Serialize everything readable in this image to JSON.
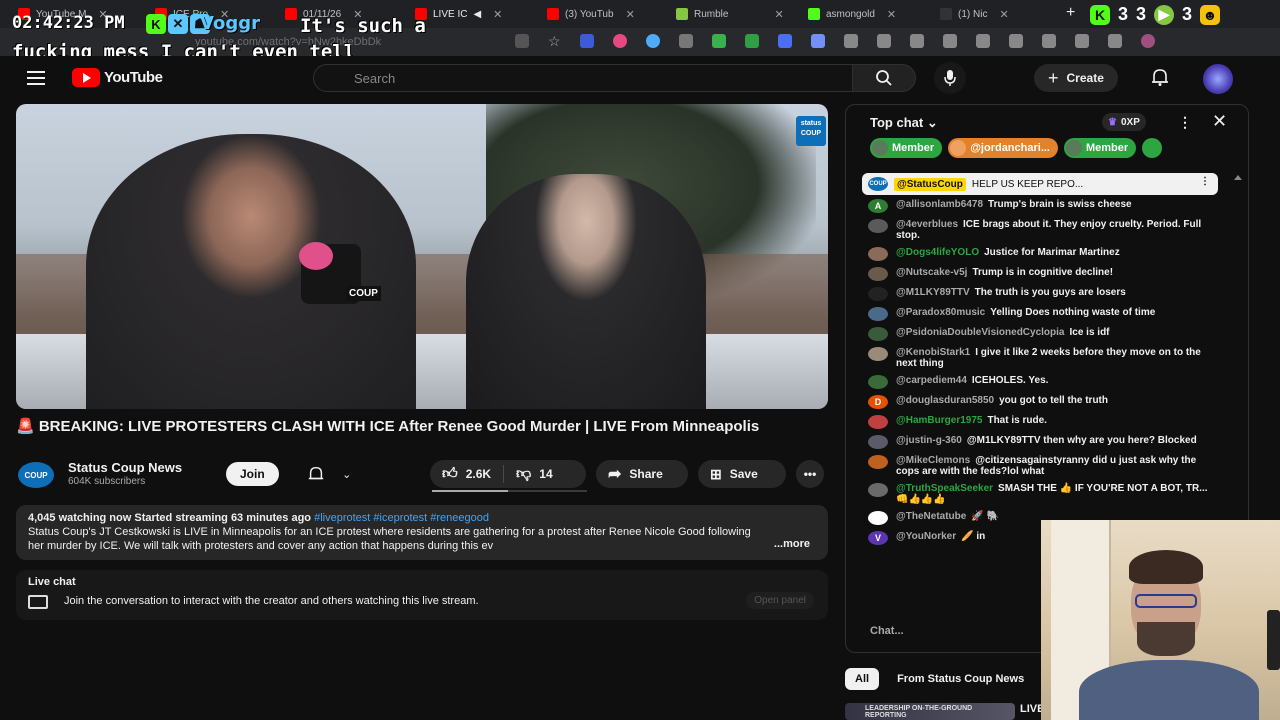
{
  "browser": {
    "tabs": [
      {
        "label": "YouTube M",
        "color": "#ff0000"
      },
      {
        "label": "ICE Pro",
        "color": "#ff0000"
      },
      {
        "label": "01/11/26",
        "color": "#ff0000"
      },
      {
        "label": "LIVE IC",
        "color": "#ff0000"
      },
      {
        "label": "(3) YouTub",
        "color": "#ff0000"
      },
      {
        "label": "Rumble",
        "color": "#85c742"
      },
      {
        "label": "asmongold",
        "color": "#53fc18"
      },
      {
        "label": "(1) Nic",
        "color": "#333333"
      }
    ],
    "url": "youtube.com/watch?v=hNw2hkeDbDk"
  },
  "overlay": {
    "clock": "02:42:23 PM",
    "caption_user": "Voggr",
    "caption_text": "It's such a fucking mess I can't even tell",
    "ext_count": "3",
    "ext_count2": "3"
  },
  "masthead": {
    "logo_text": "YouTube",
    "search_placeholder": "Search",
    "create_label": "Create"
  },
  "video": {
    "mic_label": "COUP",
    "watermark": "status COUP",
    "title": "🚨 BREAKING: LIVE PROTESTERS CLASH WITH ICE After Renee Good Murder | LIVE From Minneapolis",
    "channel": {
      "logo": "COUP",
      "name": "Status Coup News",
      "subscribers": "604K subscribers",
      "join_label": "Join"
    },
    "actions": {
      "likes": "2.6K",
      "dislikes": "14",
      "share_label": "Share",
      "save_label": "Save"
    },
    "description": {
      "stats": "4,045 watching now  Started streaming 63 minutes ago",
      "tags": "#liveprotest #iceprotest #reneegood",
      "body": "Status Coup's JT Cestkowski is LIVE in Minneapolis for an ICE protest where residents are gathering for a protest after Renee Nicole Good following her murder by ICE. We will talk with protesters and cover any action that happens during this ev",
      "more_label": "...more"
    },
    "live_chat_box": {
      "title": "Live chat",
      "text": "Join the conversation to interact with the creator and others watching this live stream.",
      "open_label": "Open panel"
    }
  },
  "chat": {
    "header": "Top chat",
    "xp": "0XP",
    "tickers": [
      {
        "label": "Member",
        "color": "#2ba640"
      },
      {
        "label": "@jordanchari...",
        "color": "#e2822a"
      },
      {
        "label": "Member",
        "color": "#2ba640"
      }
    ],
    "pinned": {
      "avatar": "COUP",
      "user": "@StatusCoup",
      "text": "HELP US KEEP REPO..."
    },
    "messages": [
      {
        "initial": "A",
        "avatar_color": "#2e7d32",
        "user": "@allisonlamb6478",
        "member": false,
        "text": "Trump's brain is swiss cheese"
      },
      {
        "initial": "",
        "avatar_color": "#5a5a5a",
        "user": "@4everblues",
        "member": false,
        "text": "ICE brags about it. They enjoy cruelty. Period. Full stop."
      },
      {
        "initial": "",
        "avatar_color": "#8a6a5a",
        "user": "@Dogs4lifeYOLO",
        "member": true,
        "text": "Justice for Marimar Martinez"
      },
      {
        "initial": "",
        "avatar_color": "#6a5a4a",
        "user": "@Nutscake-v5j",
        "member": false,
        "text": "Trump is in cognitive decline!"
      },
      {
        "initial": "",
        "avatar_color": "#222222",
        "user": "@M1LKY89TTV",
        "member": false,
        "text": "The truth is you guys are losers"
      },
      {
        "initial": "",
        "avatar_color": "#4a6a8a",
        "user": "@Paradox80music",
        "member": false,
        "text": "Yelling Does nothing waste of time"
      },
      {
        "initial": "",
        "avatar_color": "#3a5a3a",
        "user": "@PsidoniaDoubleVisionedCyclopia",
        "member": false,
        "text": "Ice is idf"
      },
      {
        "initial": "",
        "avatar_color": "#9a8a7a",
        "user": "@KenobiStark1",
        "member": false,
        "text": "I give it like 2 weeks before they move on to the next thing"
      },
      {
        "initial": "",
        "avatar_color": "#3a6a3a",
        "user": "@carpediem44",
        "member": false,
        "text": "ICEHOLES. Yes."
      },
      {
        "initial": "D",
        "avatar_color": "#e65100",
        "user": "@douglasduran5850",
        "member": false,
        "text": "you got to tell the truth"
      },
      {
        "initial": "",
        "avatar_color": "#c04040",
        "user": "@HamBurger1975",
        "member": true,
        "text": "That is rude."
      },
      {
        "initial": "",
        "avatar_color": "#5a5a6a",
        "user": "@justin-g-360",
        "member": false,
        "text": "@M1LKY89TTV then why are you here? Blocked"
      },
      {
        "initial": "",
        "avatar_color": "#c06020",
        "user": "@MikeClemons",
        "member": false,
        "text": "@citizensagainstyranny did u just ask why the cops are with the feds?lol what"
      },
      {
        "initial": "",
        "avatar_color": "#6a6a6a",
        "user": "@TruthSpeakSeeker",
        "member": true,
        "text": "SMASH THE 👍 IF YOU'RE NOT A BOT, TR... 👊👍👍👍"
      },
      {
        "initial": "",
        "avatar_color": "#ffffff",
        "user": "@TheNetatube",
        "member": false,
        "text": "🚀 🐘"
      },
      {
        "initial": "V",
        "avatar_color": "#5e35b1",
        "user": "@YouNorker",
        "member": false,
        "text": "🥖 in"
      }
    ],
    "input_placeholder": "Chat...",
    "filters": [
      "All",
      "From Status Coup News"
    ],
    "rec_thumb_text": "LEADERSHIP ON-THE-GROUND REPORTING",
    "rec_title": "LIVE"
  }
}
